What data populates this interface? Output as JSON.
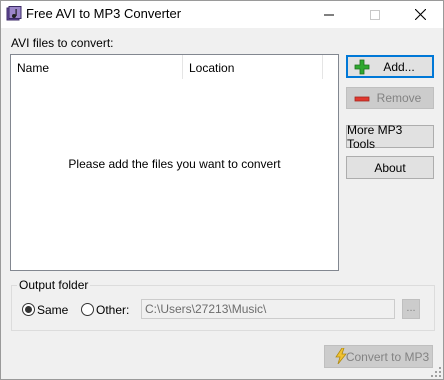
{
  "window": {
    "title": "Free AVI to MP3 Converter",
    "icon": "app-icon"
  },
  "files": {
    "label": "AVI files to convert:",
    "columns": [
      "Name",
      "Location"
    ],
    "empty_message": "Please add the files you want to convert"
  },
  "actions": {
    "add_label": "Add...",
    "remove_label": "Remove",
    "more_tools_label": "More MP3 Tools",
    "about_label": "About",
    "convert_label": "Convert to MP3"
  },
  "output": {
    "legend": "Output folder",
    "same_label": "Same",
    "other_label": "Other:",
    "selected": "Same",
    "path": "C:\\Users\\27213\\Music\\",
    "browse_label": "..."
  },
  "colors": {
    "add_icon": "#2fa82f",
    "remove_icon": "#e0382f",
    "focus_border": "#0078d7"
  }
}
